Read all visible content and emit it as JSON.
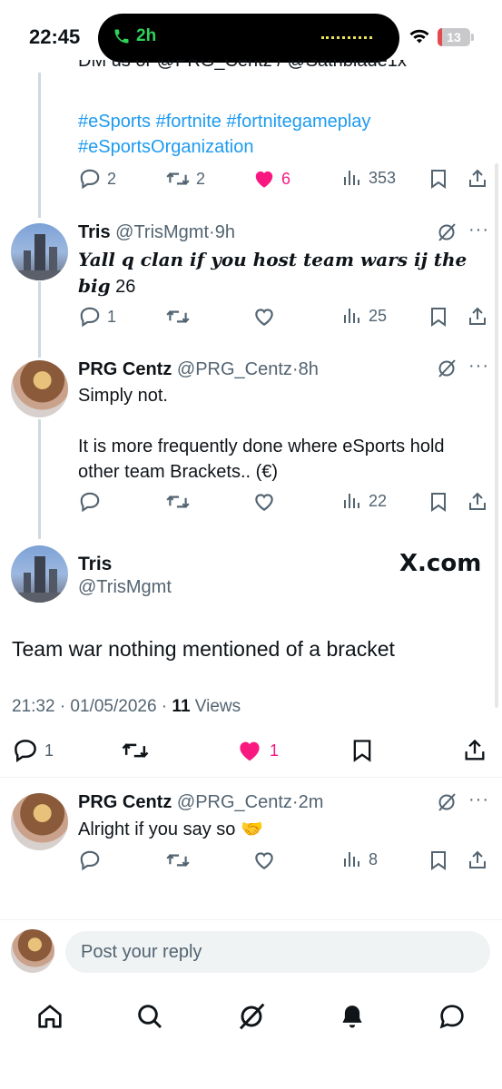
{
  "status_bar": {
    "time": "22:45",
    "call_duration": "2h",
    "battery": "13",
    "battery_level": 0.13
  },
  "partial_text": "DM us or @PRG_Centz / @Sathblade1x",
  "hashtags": [
    "#eSports #fortnite #fortnitegameplay",
    "#eSportsOrganization"
  ],
  "tweet0": {
    "replies": "2",
    "reposts": "2",
    "likes": "6",
    "views": "353"
  },
  "tweet1": {
    "name": "Tris",
    "handle": "@TrisMgmt",
    "dot": "·",
    "time": "9h",
    "text_fancy": "Yall q clan if you host team wars ij the big",
    "text_tail": " 26",
    "replies": "1",
    "views": "25"
  },
  "tweet2": {
    "name": "PRG Centz",
    "handle": "@PRG_Centz",
    "dot": "·",
    "time": "8h",
    "line1": "Simply not.",
    "line2": "It is more frequently done where eSports hold other team Brackets.. (€)",
    "views": "22"
  },
  "focus": {
    "name": "Tris",
    "handle": "@TrisMgmt",
    "source": "X.com",
    "text": "Team war nothing mentioned of a bracket",
    "timestamp": "21:32 · 01/05/2026 · ",
    "views_count": "11",
    "views_label": " Views",
    "replies": "1",
    "likes": "1"
  },
  "tweet3": {
    "name": "PRG Centz",
    "handle": "@PRG_Centz",
    "dot": "·",
    "time": "2m",
    "text": "Alright if you say so 🤝",
    "views": "8"
  },
  "reply": {
    "placeholder": "Post your reply"
  },
  "tabs": [
    {
      "icon": "home-icon"
    },
    {
      "icon": "search-icon"
    },
    {
      "icon": "grok-icon"
    },
    {
      "icon": "notifications-icon"
    },
    {
      "icon": "messages-icon"
    }
  ],
  "colors": {
    "accent": "#1d9bf0",
    "like": "#f91880",
    "muted": "#536471",
    "text": "#0f1419"
  }
}
